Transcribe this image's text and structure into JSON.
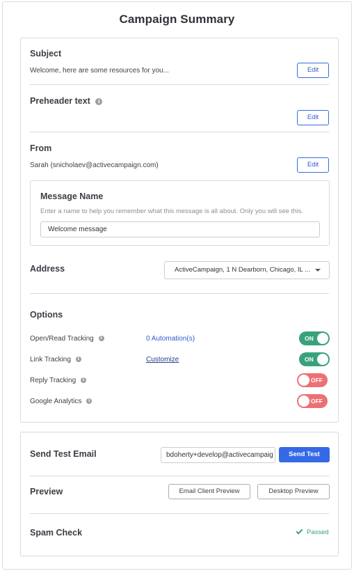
{
  "page": {
    "title": "Campaign Summary"
  },
  "subject": {
    "label": "Subject",
    "value": "Welcome, here are some resources for you...",
    "edit_label": "Edit"
  },
  "preheader": {
    "label": "Preheader text",
    "edit_label": "Edit"
  },
  "from": {
    "label": "From",
    "value": "Sarah (snicholaev@activecampaign.com)",
    "edit_label": "Edit"
  },
  "message_name": {
    "label": "Message Name",
    "help": "Enter a name to help you remember what this message is all about. Only you will see this.",
    "value": "Welcome message"
  },
  "address": {
    "label": "Address",
    "selected": "ActiveCampaign, 1 N Dearborn, Chicago, IL ..."
  },
  "options": {
    "label": "Options",
    "items": [
      {
        "label": "Open/Read Tracking",
        "link": "0 Automation(s)",
        "state": "ON"
      },
      {
        "label": "Link Tracking",
        "link": "Customize",
        "state": "ON"
      },
      {
        "label": "Reply Tracking",
        "link": "",
        "state": "OFF"
      },
      {
        "label": "Google Analytics",
        "link": "",
        "state": "OFF"
      }
    ]
  },
  "send_test": {
    "label": "Send Test Email",
    "email": "bdoherty+develop@activecampaig",
    "button": "Send Test"
  },
  "preview": {
    "label": "Preview",
    "email_client_button": "Email Client Preview",
    "desktop_button": "Desktop Preview"
  },
  "spam_check": {
    "label": "Spam Check",
    "status": "Passed"
  },
  "colors": {
    "accent": "#356ae6",
    "on": "#3aa27b",
    "off": "#ed7074"
  }
}
